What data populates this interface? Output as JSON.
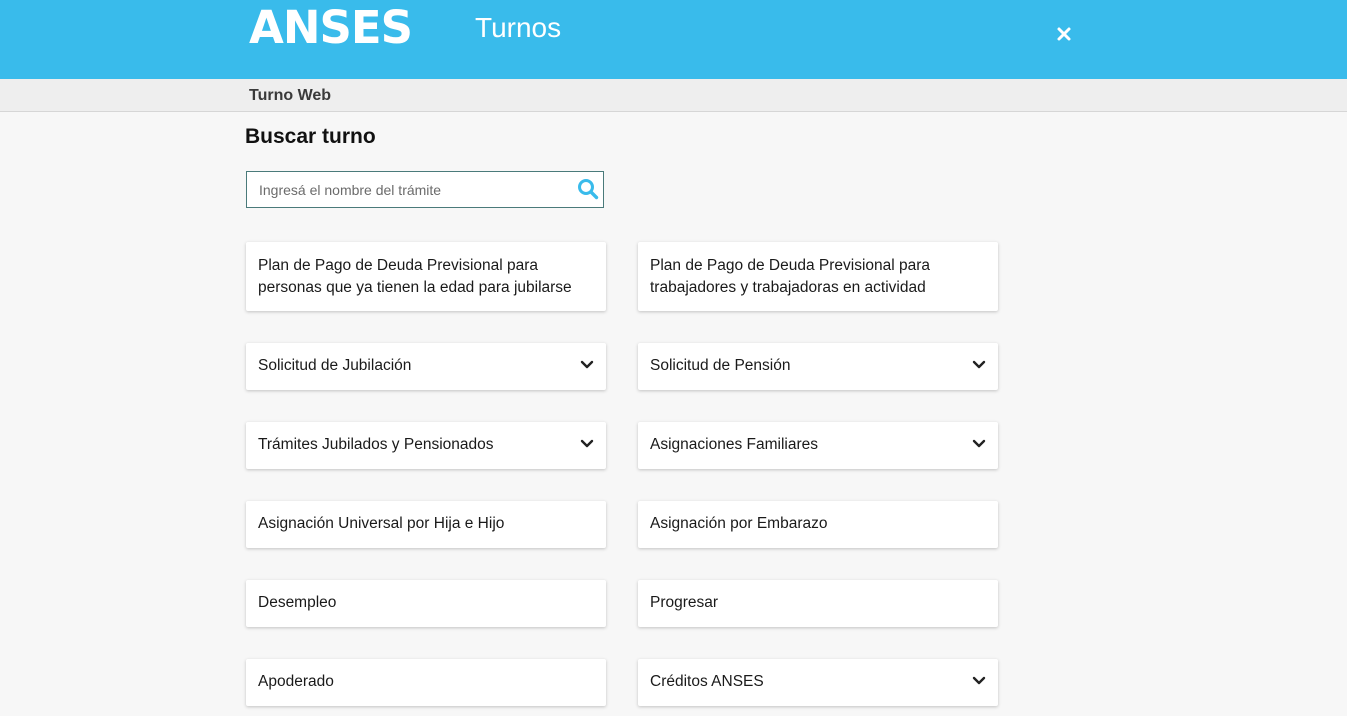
{
  "header": {
    "logo_text": "ANSES",
    "app_title": "Turnos",
    "background_color": "#39bbeb",
    "close_icon": "close-icon"
  },
  "subbar": {
    "label": "Turno Web"
  },
  "main": {
    "title": "Buscar turno",
    "search": {
      "placeholder": "Ingresá el nombre del trámite",
      "value": "",
      "icon": "search-icon",
      "icon_color": "#39bbeb"
    },
    "cards": [
      {
        "label": "Plan de Pago de Deuda Previsional para personas que ya tienen la edad para jubilarse",
        "expandable": false
      },
      {
        "label": "Plan de Pago de Deuda Previsional para trabajadores y trabajadoras en actividad",
        "expandable": false
      },
      {
        "label": "Solicitud de Jubilación",
        "expandable": true
      },
      {
        "label": "Solicitud de Pensión",
        "expandable": true
      },
      {
        "label": "Trámites Jubilados y Pensionados",
        "expandable": true
      },
      {
        "label": "Asignaciones Familiares",
        "expandable": true
      },
      {
        "label": "Asignación Universal por Hija e Hijo",
        "expandable": false
      },
      {
        "label": "Asignación por Embarazo",
        "expandable": false
      },
      {
        "label": "Desempleo",
        "expandable": false
      },
      {
        "label": "Progresar",
        "expandable": false
      },
      {
        "label": "Apoderado",
        "expandable": false
      },
      {
        "label": "Créditos ANSES",
        "expandable": true
      }
    ]
  }
}
